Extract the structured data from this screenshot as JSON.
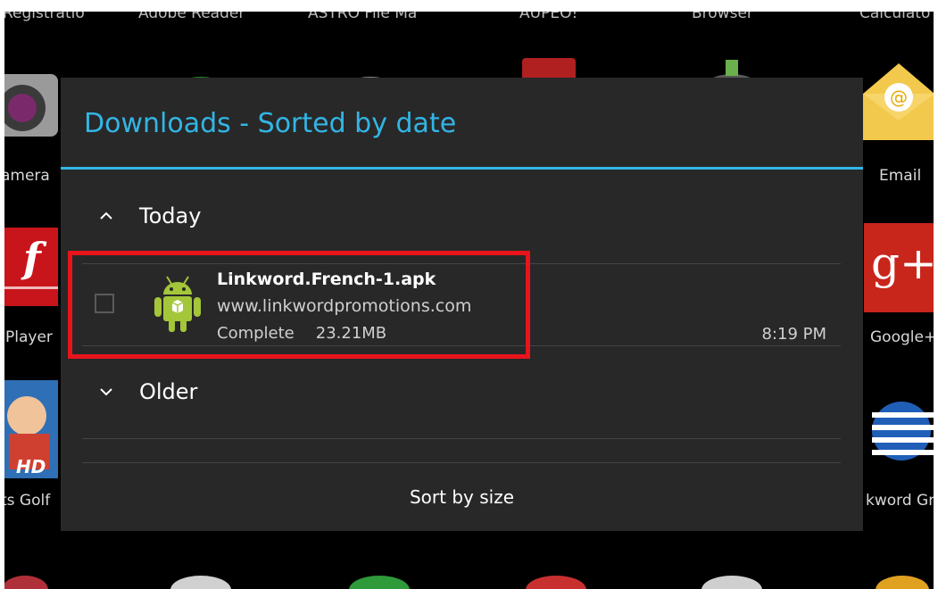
{
  "launcher": {
    "top_row_labels": [
      "Registratio",
      "Adobe Reader",
      "ASTRO File Ma",
      "AUPEO!",
      "Browser",
      "Calculato"
    ],
    "left_labels": [
      "amera",
      "Player",
      "ts Golf"
    ],
    "right_labels": [
      "Email",
      "Google+",
      "kword Gr"
    ]
  },
  "dialog": {
    "title": "Downloads - Sorted by date",
    "groups": {
      "today": "Today",
      "older": "Older"
    },
    "item": {
      "file_name": "Linkword.French-1.apk",
      "url": "www.linkwordpromotions.com",
      "status": "Complete",
      "size": "23.21MB",
      "time": "8:19 PM",
      "icon": "android-icon",
      "checked": false
    },
    "sort_button": "Sort by size"
  },
  "colors": {
    "accent": "#33b5e5",
    "highlight": "#e8141b",
    "dialog_bg": "#282828"
  }
}
